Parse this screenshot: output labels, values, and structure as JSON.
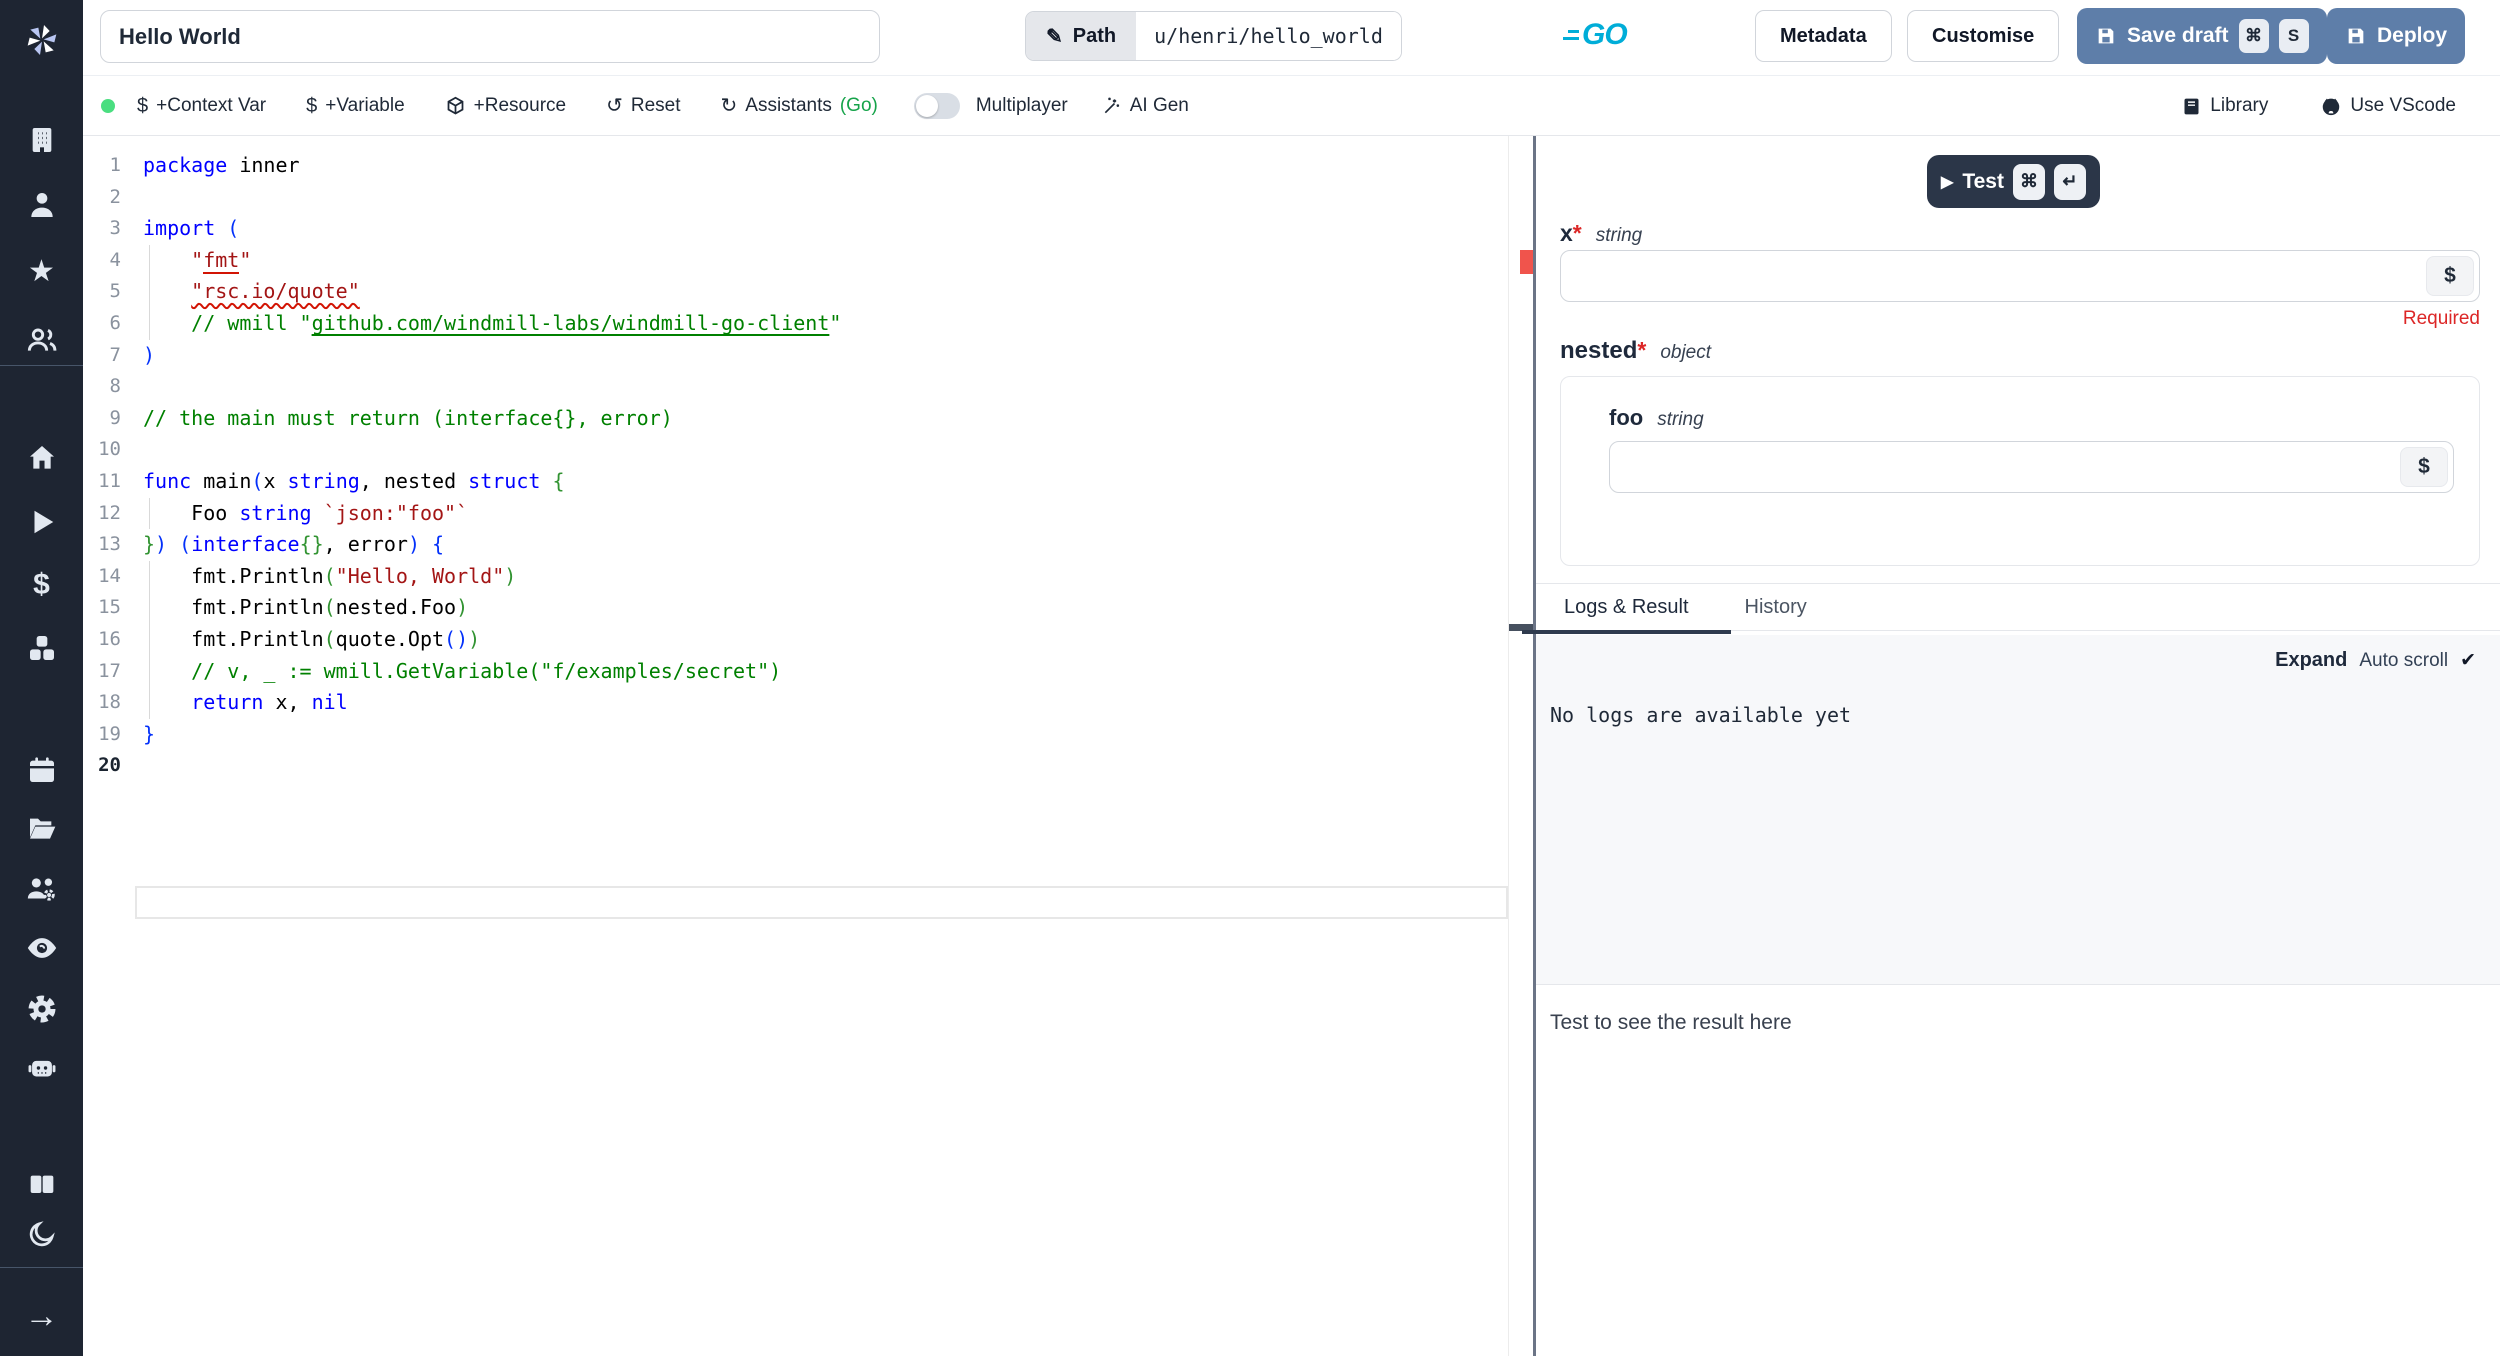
{
  "topbar": {
    "title": "Hello World",
    "path": {
      "label": "Path",
      "pencil_icon": "✎",
      "value": "u/henri/hello_world"
    },
    "lang_logo": "GO",
    "metadata": "Metadata",
    "customise": "Customise",
    "save_draft": {
      "label": "Save draft",
      "kbd_cmd": "⌘",
      "kbd_key": "S"
    },
    "deploy": "Deploy"
  },
  "toolbar": {
    "context_var_icon": "$",
    "context_var": "+Context Var",
    "variable_icon": "$",
    "variable": "+Variable",
    "resource": "+Resource",
    "reset_icon": "↺",
    "reset": "Reset",
    "assistants_icon": "↻",
    "assistants": "Assistants",
    "assistants_lang": "(Go)",
    "multiplayer": "Multiplayer",
    "ai_gen": "AI Gen",
    "library": "Library",
    "use_vscode": "Use VScode"
  },
  "sidebar": {
    "icons": [
      "windmill-logo",
      "workspace-building",
      "user",
      "favorites-star",
      "groups-users",
      "home",
      "runs-play",
      "variables-dollar",
      "resources-cubes",
      "schedules-calendar",
      "folders-folder",
      "workers-users-gear",
      "audit-logs-eye",
      "settings-gear",
      "ai-robot",
      "docs-book",
      "dark-mode-moon",
      "collapse-arrow-right"
    ],
    "dollar_glyph": "$",
    "arrow_glyph": "→",
    "star_glyph": "★"
  },
  "editor": {
    "lines": [
      {
        "n": 1,
        "toks": [
          [
            "k",
            "package"
          ],
          [
            "p",
            " inner"
          ]
        ]
      },
      {
        "n": 2,
        "toks": []
      },
      {
        "n": 3,
        "toks": [
          [
            "k",
            "import"
          ],
          [
            "p",
            " "
          ],
          [
            "b1",
            "("
          ]
        ]
      },
      {
        "n": 4,
        "g": 1,
        "toks": [
          [
            "p",
            "    "
          ],
          [
            "s",
            "\""
          ],
          [
            "su",
            "fmt"
          ],
          [
            "s",
            "\""
          ]
        ]
      },
      {
        "n": 5,
        "g": 1,
        "toks": [
          [
            "p",
            "    "
          ],
          [
            "sw",
            "\"rsc.io/quote\""
          ]
        ]
      },
      {
        "n": 6,
        "g": 1,
        "toks": [
          [
            "p",
            "    "
          ],
          [
            "c",
            "// wmill \""
          ],
          [
            "cl",
            "github.com/windmill-labs/windmill-go-client"
          ],
          [
            "c",
            "\""
          ]
        ]
      },
      {
        "n": 7,
        "toks": [
          [
            "b1",
            ")"
          ]
        ]
      },
      {
        "n": 8,
        "toks": []
      },
      {
        "n": 9,
        "toks": [
          [
            "c",
            "// the main must return (interface{}, error)"
          ]
        ]
      },
      {
        "n": 10,
        "toks": []
      },
      {
        "n": 11,
        "toks": [
          [
            "k",
            "func"
          ],
          [
            "p",
            " main"
          ],
          [
            "b1",
            "("
          ],
          [
            "p",
            "x "
          ],
          [
            "k",
            "string"
          ],
          [
            "p",
            ", nested "
          ],
          [
            "k",
            "struct"
          ],
          [
            "p",
            " "
          ],
          [
            "b2",
            "{"
          ]
        ]
      },
      {
        "n": 12,
        "g": 1,
        "toks": [
          [
            "p",
            "    Foo "
          ],
          [
            "k",
            "string"
          ],
          [
            "p",
            " "
          ],
          [
            "s",
            "`json:\"foo\"`"
          ]
        ]
      },
      {
        "n": 13,
        "toks": [
          [
            "b2",
            "}"
          ],
          [
            "b1",
            ")"
          ],
          [
            "p",
            " "
          ],
          [
            "b1",
            "("
          ],
          [
            "k",
            "interface"
          ],
          [
            "b2",
            "{}"
          ],
          [
            "p",
            ", error"
          ],
          [
            "b1",
            ")"
          ],
          [
            "p",
            " "
          ],
          [
            "b1",
            "{"
          ]
        ]
      },
      {
        "n": 14,
        "g": 1,
        "toks": [
          [
            "p",
            "    fmt.Println"
          ],
          [
            "b2",
            "("
          ],
          [
            "s",
            "\"Hello, World\""
          ],
          [
            "b2",
            ")"
          ]
        ]
      },
      {
        "n": 15,
        "g": 1,
        "toks": [
          [
            "p",
            "    fmt.Println"
          ],
          [
            "b2",
            "("
          ],
          [
            "p",
            "nested.Foo"
          ],
          [
            "b2",
            ")"
          ]
        ]
      },
      {
        "n": 16,
        "g": 1,
        "toks": [
          [
            "p",
            "    fmt.Println"
          ],
          [
            "b2",
            "("
          ],
          [
            "p",
            "quote.Opt"
          ],
          [
            "b1",
            "()"
          ],
          [
            "b2",
            ")"
          ]
        ]
      },
      {
        "n": 17,
        "g": 1,
        "toks": [
          [
            "c",
            "    // v, _ := wmill.GetVariable(\"f/examples/secret\")"
          ]
        ]
      },
      {
        "n": 18,
        "g": 1,
        "toks": [
          [
            "p",
            "    "
          ],
          [
            "k",
            "return"
          ],
          [
            "p",
            " x, "
          ],
          [
            "k",
            "nil"
          ]
        ]
      },
      {
        "n": 19,
        "toks": [
          [
            "b1",
            "}"
          ]
        ]
      },
      {
        "n": 20,
        "cur": 1,
        "toks": []
      }
    ]
  },
  "panel": {
    "test": {
      "play_icon": "▶",
      "label": "Test",
      "kbd_cmd": "⌘",
      "kbd_enter": "↵"
    },
    "x_field": {
      "name": "x",
      "required_mark": "*",
      "type": "string",
      "value": "",
      "dollar": "$",
      "required_note": "Required"
    },
    "nested_field": {
      "name": "nested",
      "required_mark": "*",
      "type": "object"
    },
    "foo_field": {
      "name": "foo",
      "type": "string",
      "value": "",
      "dollar": "$"
    },
    "tabs": {
      "logs": "Logs & Result",
      "history": "History"
    },
    "logs": {
      "expand": "Expand",
      "autoscroll": "Auto scroll",
      "check": "✔",
      "empty": "No logs are available yet"
    },
    "result_hint": "Test to see the result here"
  },
  "colors": {
    "sidebar_dark": "#1e2532",
    "accent_blue": "#5e7ea9",
    "button_dark": "#2b3648",
    "go_cyan": "#00ADD8",
    "green_dot": "#4ade80",
    "assistants_green": "#16a34a",
    "error_red": "#dc2626",
    "ruler_marker_red": "#f0544c",
    "keyword_blue": "#0000ff",
    "string_red": "#a31515",
    "comment_green": "#008000"
  }
}
